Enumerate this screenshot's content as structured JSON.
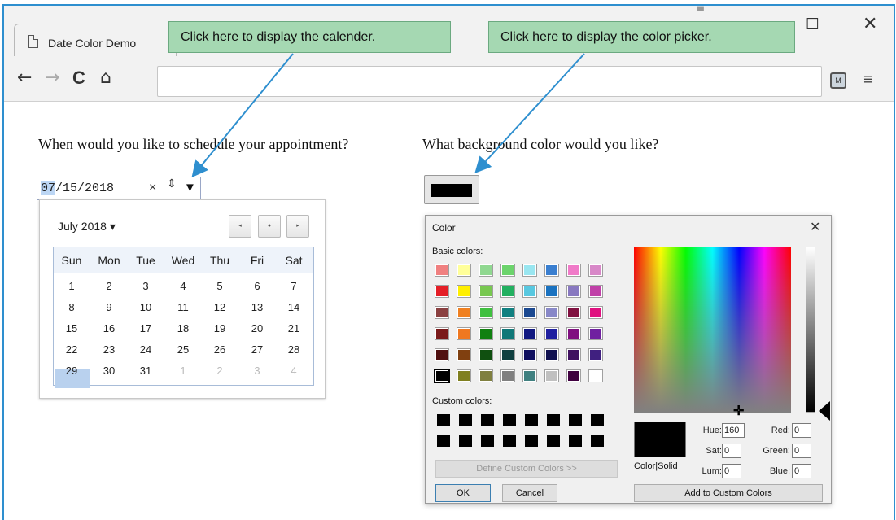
{
  "browser": {
    "tab_title": "Date Color Demo",
    "window_controls": {
      "minimize": "—",
      "maximize": "☐",
      "close": "✕"
    },
    "nav": {
      "back": "←",
      "forward": "→",
      "reload": "C",
      "home": "⌂"
    },
    "address_bar_value": "",
    "extension_label": "M",
    "menu_glyph": "≡"
  },
  "callouts": {
    "calendar": "Click here to display the calender.",
    "color": "Click here to display the color picker."
  },
  "page": {
    "question_date": "When would you like to schedule your appointment?",
    "question_color": "What background color would you like?",
    "date_input": {
      "month": "07",
      "rest": "/15/2018",
      "clear": "×",
      "spin": "⇕",
      "dropdown": "▼"
    },
    "selected_color": "#000000"
  },
  "calendar": {
    "month_label": "July 2018 ▾",
    "nav": {
      "prev": "◂",
      "today": "●",
      "next": "▸"
    },
    "weekdays": [
      "Sun",
      "Mon",
      "Tue",
      "Wed",
      "Thu",
      "Fri",
      "Sat"
    ],
    "weeks": [
      [
        "1",
        "2",
        "3",
        "4",
        "5",
        "6",
        "7"
      ],
      [
        "8",
        "9",
        "10",
        "11",
        "12",
        "13",
        "14"
      ],
      [
        "15",
        "16",
        "17",
        "18",
        "19",
        "20",
        "21"
      ],
      [
        "22",
        "23",
        "24",
        "25",
        "26",
        "27",
        "28"
      ],
      [
        "29",
        "30",
        "31",
        "1",
        "2",
        "3",
        "4"
      ]
    ],
    "selected_day": "15"
  },
  "color_dialog": {
    "title": "Color",
    "close": "✕",
    "basic_colors_label": "Basic colors:",
    "custom_colors_label": "Custom colors:",
    "basic_colors": [
      [
        "#f08080",
        "#ffff99",
        "#90d890",
        "#6cd46c",
        "#99e6f0",
        "#3a7fd0",
        "#f07ac8",
        "#d888c8"
      ],
      [
        "#e41e26",
        "#ffef00",
        "#78c850",
        "#22b060",
        "#58c8e0",
        "#1a72c0",
        "#8878c0",
        "#c040a8"
      ],
      [
        "#8a4040",
        "#f08020",
        "#40c040",
        "#108080",
        "#1a4890",
        "#8888c8",
        "#801040",
        "#e01080"
      ],
      [
        "#7a1a1a",
        "#f07820",
        "#108010",
        "#107878",
        "#101880",
        "#2020a0",
        "#801080",
        "#7020a0"
      ],
      [
        "#501010",
        "#804010",
        "#105010",
        "#104040",
        "#101060",
        "#101050",
        "#401060",
        "#402080"
      ],
      [
        "#000000",
        "#808020",
        "#808040",
        "#808080",
        "#408080",
        "#c0c0c0",
        "#400040",
        "#ffffff"
      ]
    ],
    "selected_basic": "#000000",
    "define_custom_button": "Define Custom Colors >>",
    "ok_button": "OK",
    "cancel_button": "Cancel",
    "preview_label": "Color|Solid",
    "hue_label": "Hue:",
    "hue": "160",
    "sat_label": "Sat:",
    "sat": "0",
    "lum_label": "Lum:",
    "lum": "0",
    "red_label": "Red:",
    "red": "0",
    "green_label": "Green:",
    "green": "0",
    "blue_label": "Blue:",
    "blue": "0",
    "add_custom_button": "Add to Custom Colors"
  }
}
